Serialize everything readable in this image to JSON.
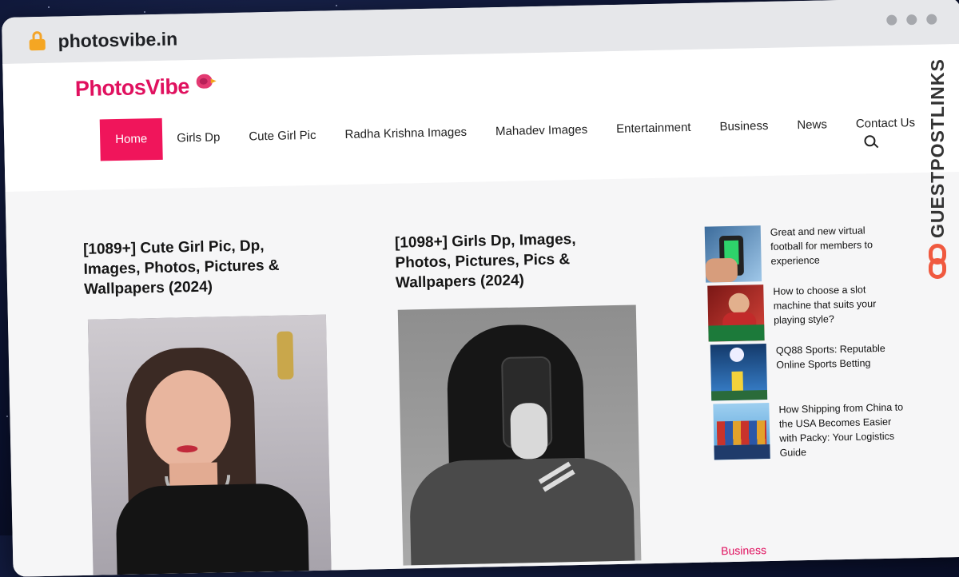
{
  "browser": {
    "url": "photosvibe.in"
  },
  "site": {
    "logo": {
      "part1": "Photos",
      "part2": "Vibe"
    },
    "nav": [
      {
        "label": "Home",
        "active": true
      },
      {
        "label": "Girls Dp"
      },
      {
        "label": "Cute Girl Pic"
      },
      {
        "label": "Radha Krishna Images"
      },
      {
        "label": "Mahadev Images"
      },
      {
        "label": "Entertainment"
      },
      {
        "label": "Business"
      },
      {
        "label": "News"
      },
      {
        "label": "Contact Us"
      }
    ],
    "accent_color": "#f0155b"
  },
  "posts": [
    {
      "title": "[1089+] Cute Girl Pic, Dp, Images, Photos, Pictures & Wallpapers (2024)"
    },
    {
      "title": "[1098+] Girls Dp, Images, Photos, Pictures, Pics & Wallpapers (2024)"
    }
  ],
  "sidebar": {
    "items": [
      {
        "title": "Great and new virtual football for members to experience"
      },
      {
        "title": "How to choose a slot machine that suits your playing style?"
      },
      {
        "title": "QQ88 Sports: Reputable Online Sports Betting"
      },
      {
        "title": "How Shipping from China to the USA Becomes Easier with Packy: Your Logistics Guide"
      }
    ],
    "category_label": "Business"
  },
  "watermark": {
    "text": "GUESTPOSTLINKS",
    "color": "#f0593f"
  }
}
